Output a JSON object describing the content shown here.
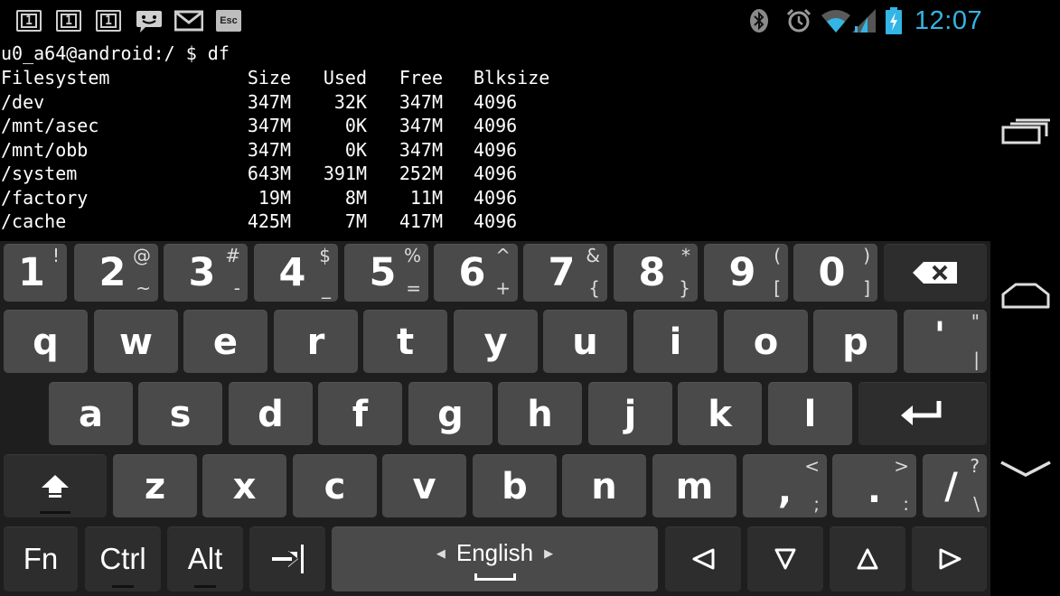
{
  "status_bar": {
    "notifications": [
      {
        "icon": "terminal-window-1-icon",
        "label": "1"
      },
      {
        "icon": "terminal-window-1-icon",
        "label": "1"
      },
      {
        "icon": "terminal-window-1-icon",
        "label": "1"
      },
      {
        "icon": "chat-bubble-icon"
      },
      {
        "icon": "mail-icon"
      },
      {
        "icon": "esc-icon",
        "label": "Esc"
      }
    ],
    "system_icons": [
      "bluetooth-icon",
      "alarm-icon",
      "wifi-icon",
      "cell-signal-icon",
      "battery-charging-icon"
    ],
    "time": "12:07",
    "accent_color": "#33b5e5"
  },
  "terminal": {
    "prompt_line": "u0_a64@android:/ $ df",
    "table": {
      "headers": [
        "Filesystem",
        "Size",
        "Used",
        "Free",
        "Blksize"
      ],
      "rows": [
        [
          "/dev",
          "347M",
          "32K",
          "347M",
          "4096"
        ],
        [
          "/mnt/asec",
          "347M",
          "0K",
          "347M",
          "4096"
        ],
        [
          "/mnt/obb",
          "347M",
          "0K",
          "347M",
          "4096"
        ],
        [
          "/system",
          "643M",
          "391M",
          "252M",
          "4096"
        ],
        [
          "/factory",
          "19M",
          "8M",
          "11M",
          "4096"
        ],
        [
          "/cache",
          "425M",
          "7M",
          "417M",
          "4096"
        ]
      ]
    }
  },
  "keyboard": {
    "number_row": [
      {
        "main": "1",
        "top": "!",
        "bottom": ""
      },
      {
        "main": "2",
        "top": "@",
        "bottom": "~"
      },
      {
        "main": "3",
        "top": "#",
        "bottom": "-"
      },
      {
        "main": "4",
        "top": "$",
        "bottom": "_"
      },
      {
        "main": "5",
        "top": "%",
        "bottom": "="
      },
      {
        "main": "6",
        "top": "^",
        "bottom": "+"
      },
      {
        "main": "7",
        "top": "&",
        "bottom": "{"
      },
      {
        "main": "8",
        "top": "*",
        "bottom": "}"
      },
      {
        "main": "9",
        "top": "(",
        "bottom": "["
      },
      {
        "main": "0",
        "top": ")",
        "bottom": "]"
      }
    ],
    "row_q": [
      "q",
      "w",
      "e",
      "r",
      "t",
      "y",
      "u",
      "i",
      "o",
      "p"
    ],
    "apostrophe_key": {
      "main": "'",
      "top": "\"",
      "bottom": "|"
    },
    "row_a": [
      "a",
      "s",
      "d",
      "f",
      "g",
      "h",
      "j",
      "k",
      "l"
    ],
    "row_z": [
      "z",
      "x",
      "c",
      "v",
      "b",
      "n",
      "m"
    ],
    "comma_key": {
      "main": ",",
      "top": "<",
      "bottom": ";"
    },
    "period_key": {
      "main": ".",
      "top": ">",
      "bottom": ":"
    },
    "slash_key": {
      "main": "/",
      "top": "?",
      "bottom": "\\"
    },
    "fn_label": "Fn",
    "ctrl_label": "Ctrl",
    "alt_label": "Alt",
    "language": "English",
    "icons": {
      "backspace": "backspace-icon",
      "enter": "enter-icon",
      "shift": "shift-icon",
      "tab": "tab-icon",
      "left": "arrow-left-icon",
      "down": "arrow-down-icon",
      "up": "arrow-up-icon",
      "right": "arrow-right-icon"
    }
  },
  "nav_bar": {
    "buttons": [
      "recent-apps-icon",
      "home-icon",
      "hide-keyboard-icon"
    ]
  }
}
